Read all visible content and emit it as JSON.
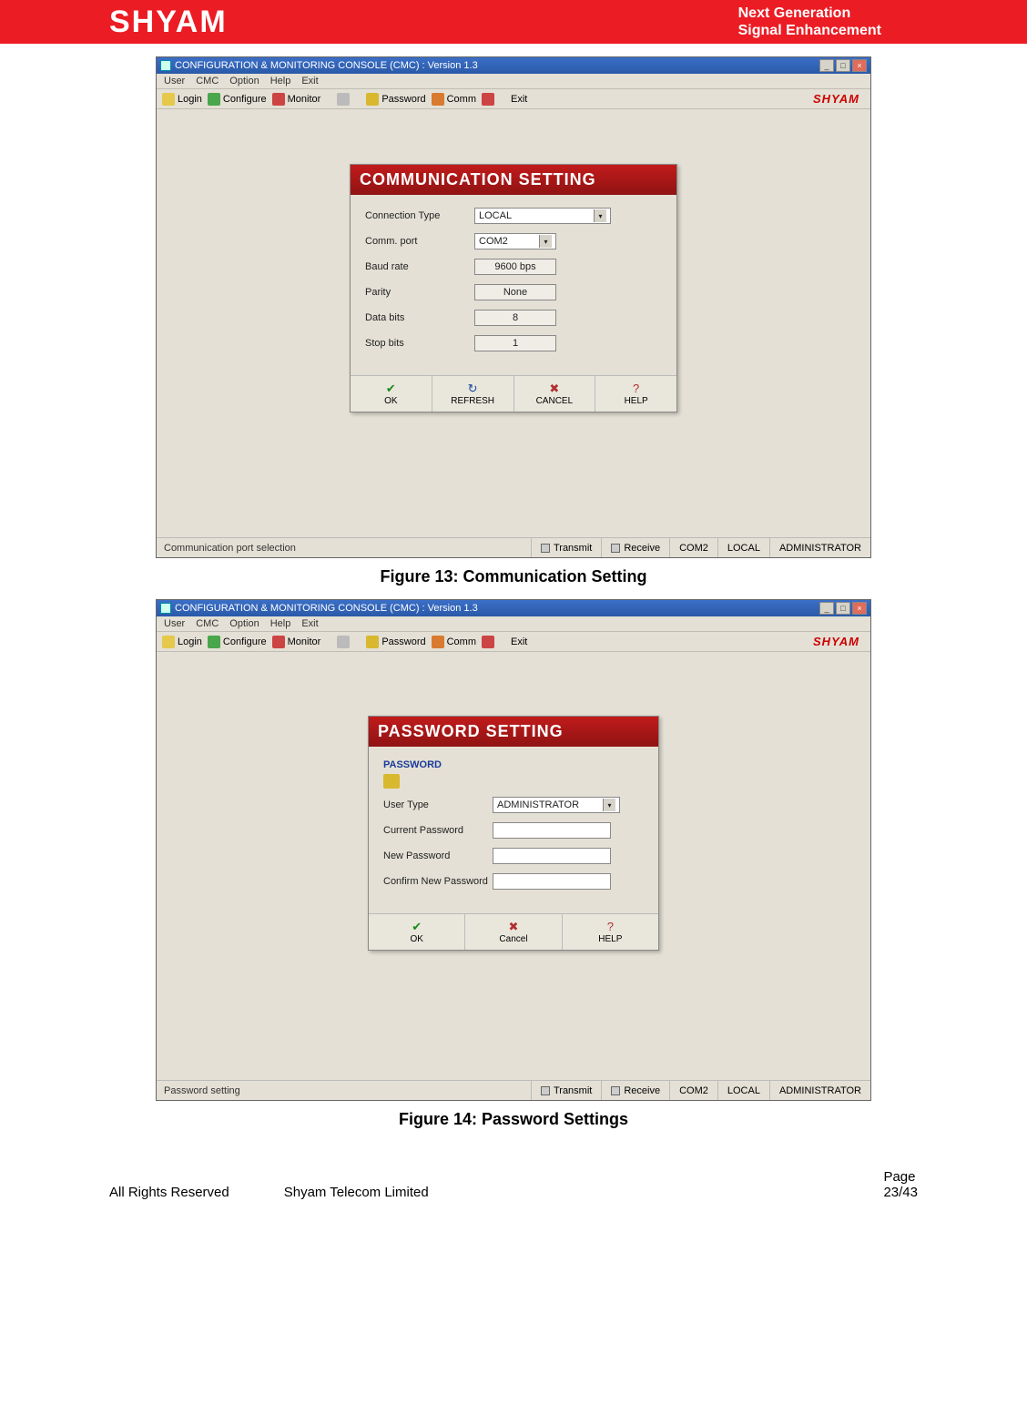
{
  "header": {
    "logo": "SHYAM",
    "tagline_l1": "Next Generation",
    "tagline_l2": "Signal Enhancement"
  },
  "captions": {
    "fig13": "Figure 13: Communication Setting",
    "fig14": "Figure 14: Password Settings"
  },
  "app": {
    "title": "CONFIGURATION & MONITORING CONSOLE (CMC)  :  Version 1.3",
    "menus": [
      "User",
      "CMC",
      "Option",
      "Help",
      "Exit"
    ],
    "toolbar": {
      "login": "Login",
      "configure": "Configure",
      "monitor": "Monitor",
      "password": "Password",
      "comm": "Comm",
      "exit": "Exit"
    },
    "brand": "SHYAM"
  },
  "commDialog": {
    "title": "COMMUNICATION SETTING",
    "fields": {
      "conn_type_label": "Connection Type",
      "conn_type_value": "LOCAL",
      "comm_port_label": "Comm. port",
      "comm_port_value": "COM2",
      "baud_label": "Baud rate",
      "baud_value": "9600 bps",
      "parity_label": "Parity",
      "parity_value": "None",
      "databits_label": "Data bits",
      "databits_value": "8",
      "stopbits_label": "Stop bits",
      "stopbits_value": "1"
    },
    "buttons": {
      "ok": "OK",
      "refresh": "REFRESH",
      "cancel": "CANCEL",
      "help": "HELP"
    }
  },
  "commStatus": {
    "msg": "Communication port selection",
    "transmit": "Transmit",
    "receive": "Receive",
    "port": "COM2",
    "mode": "LOCAL",
    "user": "ADMINISTRATOR"
  },
  "pwdDialog": {
    "title": "PASSWORD SETTING",
    "group": "PASSWORD",
    "fields": {
      "usertype_label": "User Type",
      "usertype_value": "ADMINISTRATOR",
      "current_label": "Current Password",
      "new_label": "New Password",
      "confirm_label": "Confirm New Password"
    },
    "buttons": {
      "ok": "OK",
      "cancel": "Cancel",
      "help": "HELP"
    }
  },
  "pwdStatus": {
    "msg": "Password setting",
    "transmit": "Transmit",
    "receive": "Receive",
    "port": "COM2",
    "mode": "LOCAL",
    "user": "ADMINISTRATOR"
  },
  "footer": {
    "rights": "All Rights Reserved",
    "company": "Shyam Telecom Limited",
    "page_label": "Page",
    "page_num": "23/43"
  }
}
